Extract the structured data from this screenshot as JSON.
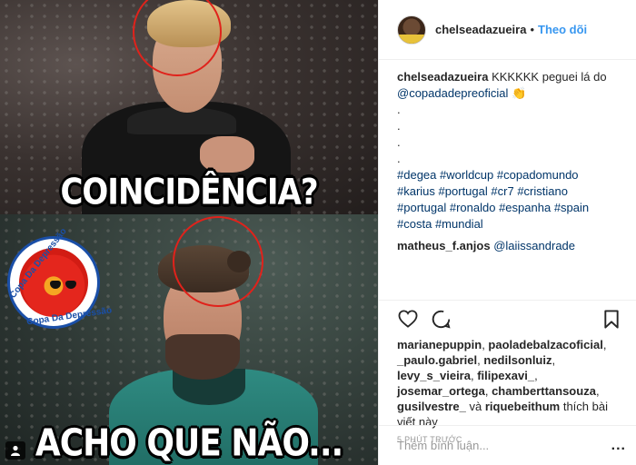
{
  "post": {
    "meme": {
      "top_caption": "COINCIDÊNCIA?",
      "bottom_caption": "ACHO QUE NÃO...",
      "badge_text_top": "Copa Da Depressão",
      "badge_text_bottom": "Copa Da Depressão"
    },
    "header": {
      "username": "chelseadazueira",
      "separator": "•",
      "follow_label": "Theo dõi"
    },
    "caption": {
      "username": "chelseadazueira",
      "text": "KKKKKK peguei lá do",
      "mention": "@copadadepreoficial",
      "emoji": "👏",
      "dots": [
        ".",
        ".",
        ".",
        "."
      ],
      "hashtags": [
        "#degea",
        "#worldcup",
        "#copadomundo",
        "#karius",
        "#portugal",
        "#cr7",
        "#cristiano",
        "#portugal",
        "#ronaldo",
        "#espanha",
        "#spain",
        "#costa",
        "#mundial"
      ]
    },
    "comment": {
      "username": "matheus_f.anjos",
      "mention": "@laiissandrade"
    },
    "likes": {
      "names": [
        "marianepuppin",
        "paoladebalzacoficial",
        "_paulo.gabriel",
        "nedilsonluiz",
        "levy_s_vieira",
        "filipexavi_",
        "josemar_ortega",
        "chamberttansouza",
        "gusilvestre_"
      ],
      "connector": "và",
      "last_name": "riquebeithum",
      "suffix": "thích bài viết này"
    },
    "timestamp": "5 PHÚT TRƯỚC",
    "add_comment": {
      "placeholder": "Thêm bình luận...",
      "more_label": "..."
    }
  },
  "icons": {
    "like": "heart-icon",
    "comment": "speech-bubble-icon",
    "save": "bookmark-icon",
    "user_tag": "person-icon"
  },
  "colors": {
    "link_blue": "#3897f0",
    "hashtag_blue": "#003569",
    "highlight_red": "#e0221b"
  }
}
